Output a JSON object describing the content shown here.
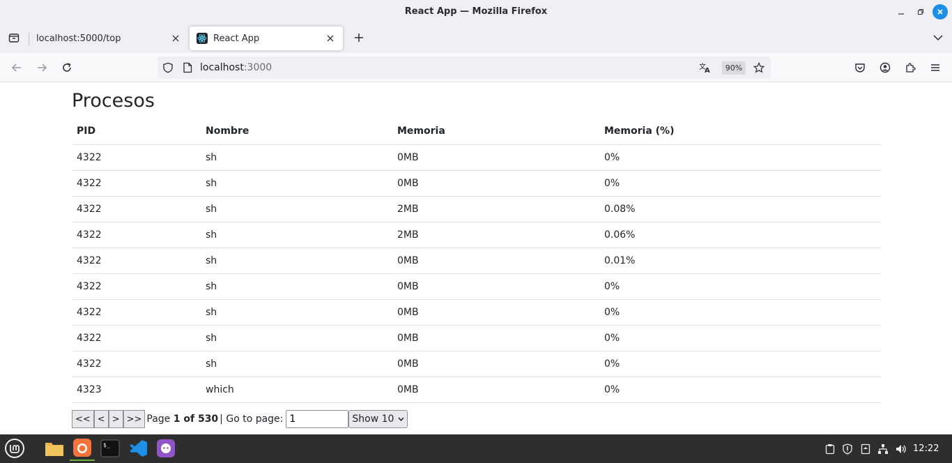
{
  "window": {
    "title": "React App — Mozilla Firefox"
  },
  "tabs": [
    {
      "label": "localhost:5000/top",
      "active": false
    },
    {
      "label": "React App",
      "active": true
    }
  ],
  "navbar": {
    "url_host": "localhost",
    "url_port": ":3000",
    "zoom": "90%"
  },
  "page": {
    "title": "Procesos",
    "columns": [
      "PID",
      "Nombre",
      "Memoria",
      "Memoria (%)"
    ],
    "rows": [
      [
        "4322",
        "sh",
        "0MB",
        "0%"
      ],
      [
        "4322",
        "sh",
        "0MB",
        "0%"
      ],
      [
        "4322",
        "sh",
        "2MB",
        "0.08%"
      ],
      [
        "4322",
        "sh",
        "2MB",
        "0.06%"
      ],
      [
        "4322",
        "sh",
        "0MB",
        "0.01%"
      ],
      [
        "4322",
        "sh",
        "0MB",
        "0%"
      ],
      [
        "4322",
        "sh",
        "0MB",
        "0%"
      ],
      [
        "4322",
        "sh",
        "0MB",
        "0%"
      ],
      [
        "4322",
        "sh",
        "0MB",
        "0%"
      ],
      [
        "4323",
        "which",
        "0MB",
        "0%"
      ]
    ]
  },
  "pager": {
    "first": "<<",
    "prev": "<",
    "next": ">",
    "last": ">>",
    "page_prefix": "Page ",
    "page_of": "1 of 530",
    "goto_label": "| Go to page:",
    "goto_value": "1",
    "show_label": "Show 10"
  },
  "taskbar": {
    "clock": "12:22"
  },
  "colors": {
    "accent": "#1f8fe6",
    "taskbar": "#2e2e2e",
    "active_indicator": "#6db442"
  }
}
